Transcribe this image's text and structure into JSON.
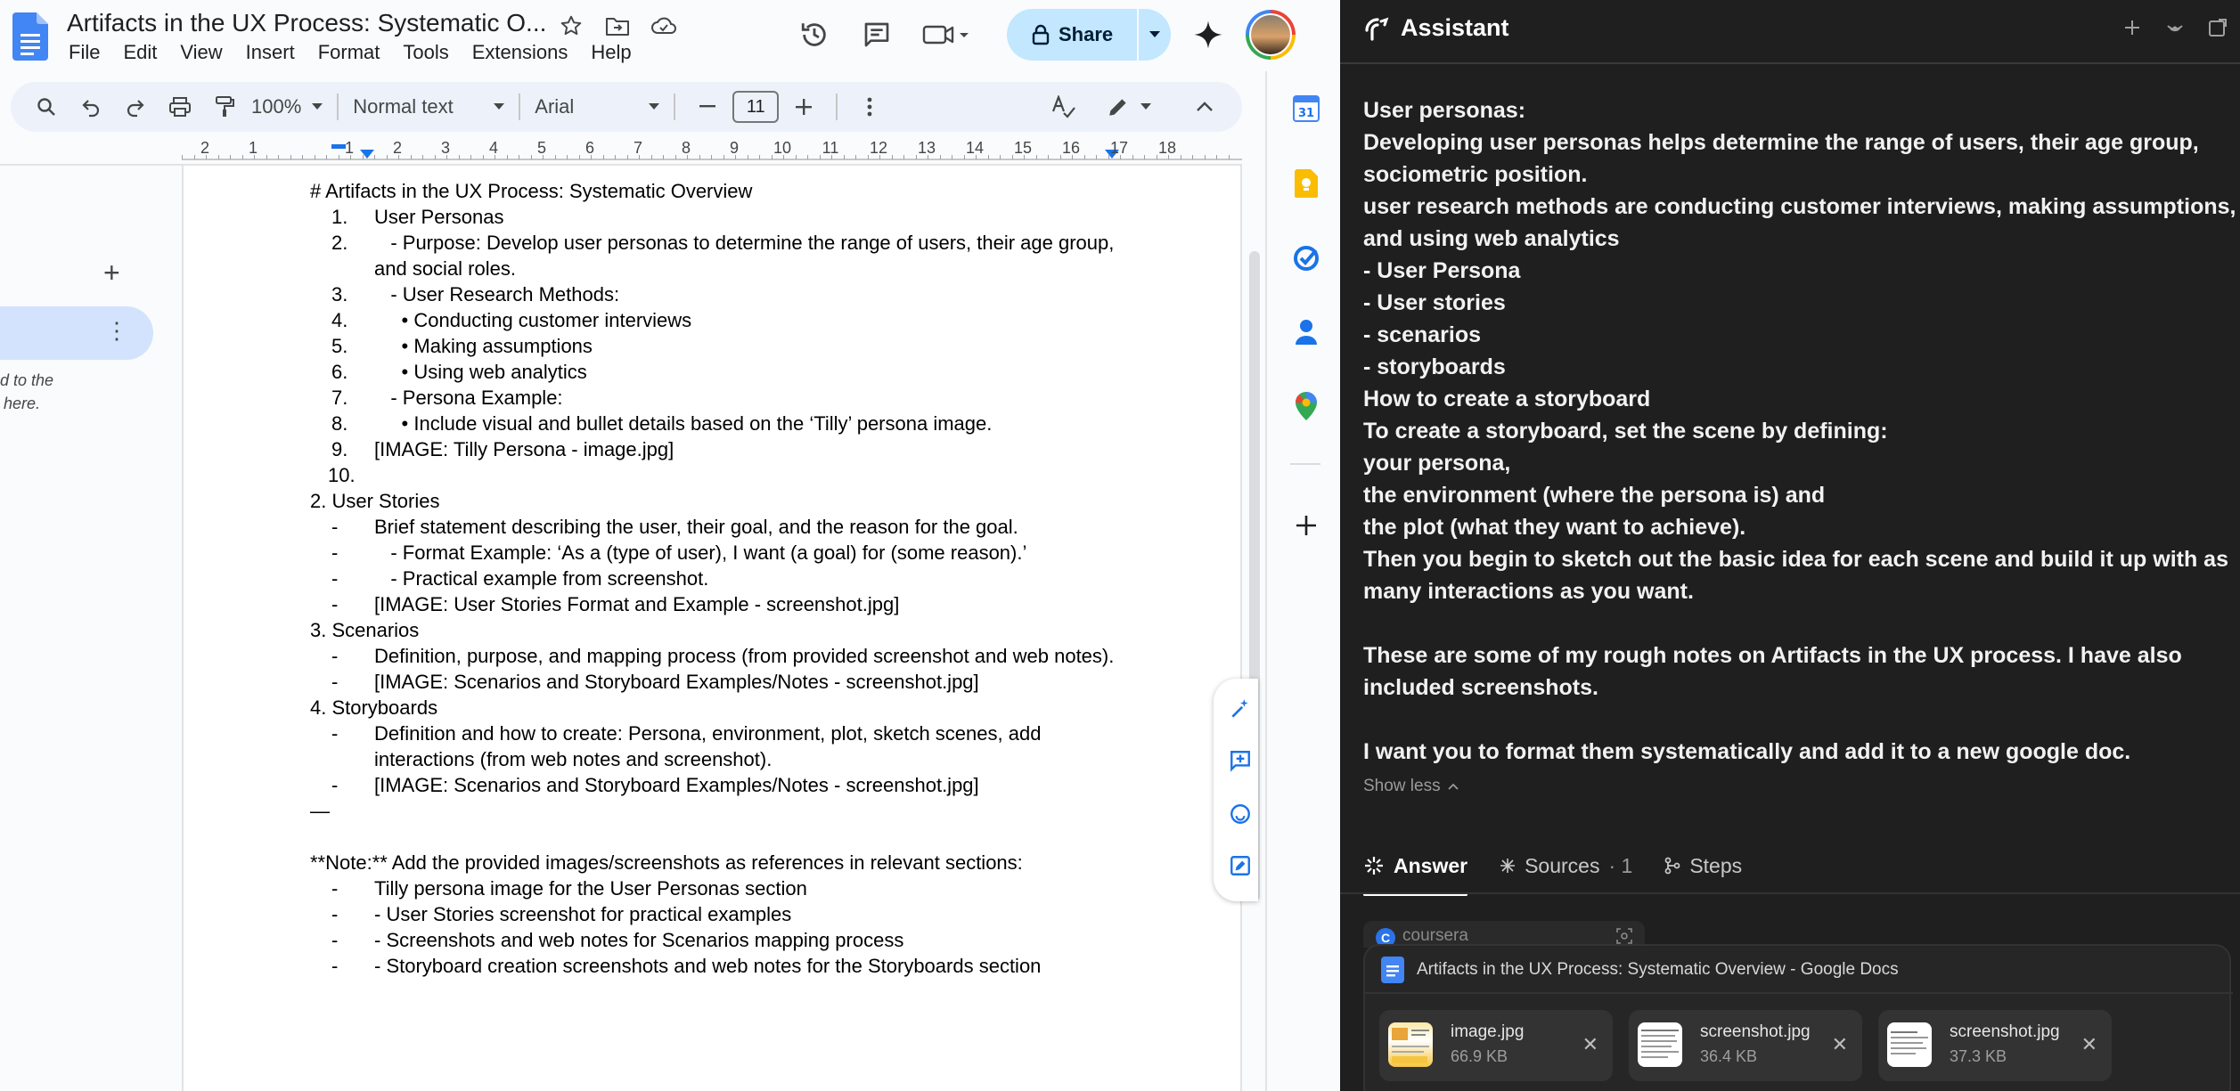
{
  "docs": {
    "title": "Artifacts in the UX Process: Systematic O...",
    "menu": [
      "File",
      "Edit",
      "View",
      "Insert",
      "Format",
      "Tools",
      "Extensions",
      "Help"
    ],
    "share_label": "Share",
    "toolbar": {
      "zoom": "100%",
      "style": "Normal text",
      "font": "Arial",
      "font_size": "11"
    },
    "ruler_numbers": [
      "2",
      "1",
      "1",
      "2",
      "3",
      "4",
      "5",
      "6",
      "7",
      "8",
      "9",
      "10",
      "11",
      "12",
      "13",
      "14",
      "15",
      "16",
      "17",
      "18"
    ],
    "left_panel_text": [
      "d to the",
      "here."
    ],
    "lines": [
      {
        "m": "",
        "t": "# Artifacts in the UX Process: Systematic Overview",
        "i": 0
      },
      {
        "m": "1.",
        "t": "User Personas",
        "i": 1
      },
      {
        "m": "2.",
        "t": "   - Purpose: Develop user personas to determine the range of users, their age group,",
        "i": 1
      },
      {
        "m": "",
        "t": "and social roles.",
        "i": 1
      },
      {
        "m": "3.",
        "t": "   - User Research Methods:",
        "i": 1
      },
      {
        "m": "4.",
        "t": "     • Conducting customer interviews",
        "i": 1
      },
      {
        "m": "5.",
        "t": "     • Making assumptions",
        "i": 1
      },
      {
        "m": "6.",
        "t": "     • Using web analytics",
        "i": 1
      },
      {
        "m": "7.",
        "t": "   - Persona Example:",
        "i": 1
      },
      {
        "m": "8.",
        "t": "     • Include visual and bullet details based on the ‘Tilly’ persona image.",
        "i": 1
      },
      {
        "m": "9.",
        "t": "[IMAGE: Tilly Persona - image.jpg]",
        "i": 1
      },
      {
        "m": "10.",
        "t": "",
        "i": 1
      },
      {
        "m": "",
        "t": "2. User Stories",
        "i": 0
      },
      {
        "m": "-",
        "t": "Brief statement describing the user, their goal, and the reason for the goal.",
        "i": 1
      },
      {
        "m": "-",
        "t": "   - Format Example: ‘As a (type of user), I want (a goal) for (some reason).’",
        "i": 1
      },
      {
        "m": "-",
        "t": "   - Practical example from screenshot.",
        "i": 1
      },
      {
        "m": "-",
        "t": "[IMAGE: User Stories Format and Example - screenshot.jpg]",
        "i": 1
      },
      {
        "m": "",
        "t": "3. Scenarios",
        "i": 0
      },
      {
        "m": "-",
        "t": "Definition, purpose, and mapping process (from provided screenshot and web notes).",
        "i": 1
      },
      {
        "m": "-",
        "t": "[IMAGE: Scenarios and Storyboard Examples/Notes - screenshot.jpg]",
        "i": 1
      },
      {
        "m": "",
        "t": "4. Storyboards",
        "i": 0
      },
      {
        "m": "-",
        "t": "Definition and how to create: Persona, environment, plot, sketch scenes, add",
        "i": 1
      },
      {
        "m": "",
        "t": "interactions (from web notes and screenshot).",
        "i": 1
      },
      {
        "m": "-",
        "t": "[IMAGE: Scenarios and Storyboard Examples/Notes - screenshot.jpg]",
        "i": 1
      },
      {
        "m": "",
        "t": "—",
        "i": 0
      },
      {
        "m": "",
        "t": "",
        "i": 0
      },
      {
        "m": "",
        "t": "**Note:** Add the provided images/screenshots as references in relevant sections:",
        "i": 0
      },
      {
        "m": "-",
        "t": "Tilly persona image for the User Personas section",
        "i": 1
      },
      {
        "m": "-",
        "t": "- User Stories screenshot for practical examples",
        "i": 1
      },
      {
        "m": "-",
        "t": "- Screenshots and web notes for Scenarios mapping process",
        "i": 1
      },
      {
        "m": "-",
        "t": "- Storyboard creation screenshots and web notes for the Storyboards section",
        "i": 1
      }
    ]
  },
  "assistant": {
    "title": "Assistant",
    "message_lines": [
      "User personas:",
      "Developing user personas helps determine the range of users, their age group,",
      "sociometric position.",
      "user research methods are conducting customer interviews, making assumptions,",
      "and using web analytics",
      "- User Persona",
      "- User stories",
      "- scenarios",
      "- storyboards",
      "How to create a storyboard",
      "To create a storyboard, set the scene by defining:",
      "your persona,",
      "the environment (where the persona is) and",
      "the plot (what they want to achieve).",
      "Then you begin to sketch out the basic idea for each scene and build it up with as",
      "many interactions as you want.",
      "",
      "These are some of my rough notes on Artifacts in the UX process. I have also",
      "included screenshots.",
      "",
      "I want you to format them systematically and add it to a new google doc."
    ],
    "show_less": "Show less",
    "tabs": {
      "answer": "Answer",
      "sources": "Sources",
      "sources_count": "· 1",
      "steps": "Steps"
    },
    "source_preview": "coursera",
    "source_badge": "C",
    "context_doc": "Artifacts in the UX Process: Systematic Overview - Google Docs",
    "attachments": [
      {
        "name": "image.jpg",
        "size": "66.9 KB"
      },
      {
        "name": "screenshot.jpg",
        "size": "36.4 KB"
      },
      {
        "name": "screenshot.jpg",
        "size": "37.3 KB"
      }
    ]
  },
  "colors": {
    "docs_blue": "#1a73e8",
    "share_bg": "#c2e7ff",
    "assistant_bg": "#1f1f1f"
  }
}
